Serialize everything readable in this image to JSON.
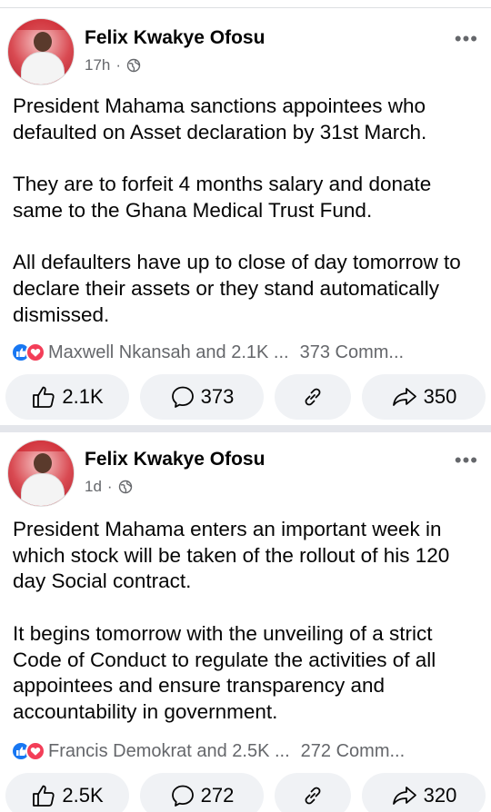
{
  "posts": [
    {
      "author": "Felix Kwakye Ofosu",
      "time": "17h",
      "time_sep": "·",
      "paragraphs": [
        "President Mahama sanctions appointees who defaulted on Asset declaration by 31st March.",
        "They are to forfeit 4 months salary and donate same to the Ghana Medical Trust Fund.",
        "All defaulters have up to close of day tomorrow to declare their assets or they stand automatically dismissed."
      ],
      "reaction_summary": "Maxwell Nkansah and 2.1K ...",
      "comments_summary": "373 Comm...",
      "like_count": "2.1K",
      "comment_count": "373",
      "share_count": "350"
    },
    {
      "author": "Felix Kwakye Ofosu",
      "time": "1d",
      "time_sep": "·",
      "paragraphs": [
        "President Mahama enters an important week in which stock will be taken of the rollout of his 120 day Social contract.",
        "It begins tomorrow with the unveiling of a strict Code of Conduct to regulate the activities of all appointees and ensure transparency and accountability in government."
      ],
      "reaction_summary": "Francis Demokrat and 2.5K ...",
      "comments_summary": "272 Comm...",
      "like_count": "2.5K",
      "comment_count": "272",
      "share_count": "320"
    }
  ],
  "icons": {
    "more": "more-options-icon",
    "audience": "globe-icon",
    "like": "thumbs-up-icon",
    "comment": "comment-bubble-icon",
    "link": "link-icon",
    "share": "share-arrow-icon"
  },
  "colors": {
    "like_blue": "#1877f2",
    "love_red": "#f33e58",
    "secondary_text": "#65676b",
    "button_bg": "#f0f2f5"
  }
}
